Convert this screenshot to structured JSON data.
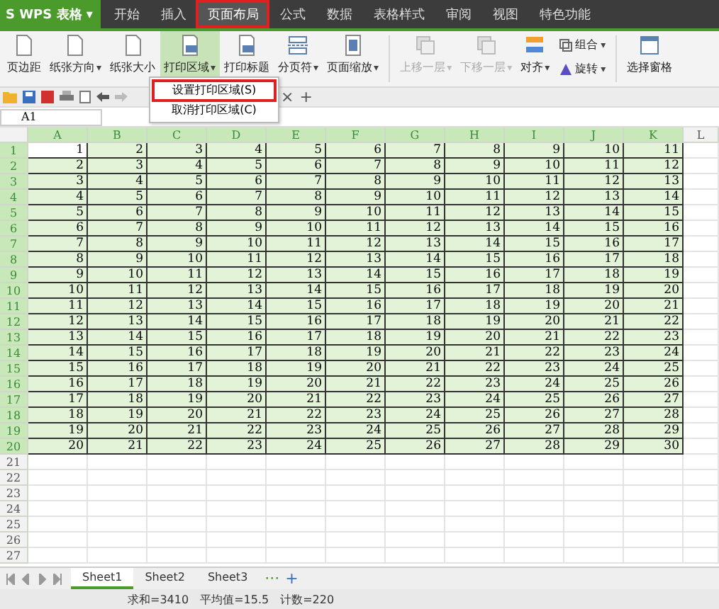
{
  "app": {
    "logo": "S",
    "name": "WPS 表格",
    "caret": "▾"
  },
  "menu_tabs": [
    {
      "label": "开始",
      "selected": false,
      "highlighted": false
    },
    {
      "label": "插入",
      "selected": false,
      "highlighted": false
    },
    {
      "label": "页面布局",
      "selected": true,
      "highlighted": true
    },
    {
      "label": "公式",
      "selected": false,
      "highlighted": false
    },
    {
      "label": "数据",
      "selected": false,
      "highlighted": false
    },
    {
      "label": "表格样式",
      "selected": false,
      "highlighted": false
    },
    {
      "label": "审阅",
      "selected": false,
      "highlighted": false
    },
    {
      "label": "视图",
      "selected": false,
      "highlighted": false
    },
    {
      "label": "特色功能",
      "selected": false,
      "highlighted": false
    }
  ],
  "ribbon": [
    {
      "kind": "large",
      "label": "页边距",
      "dropdown": false,
      "disabled": false,
      "pressed": false
    },
    {
      "kind": "large",
      "label": "纸张方向",
      "dropdown": true,
      "disabled": false,
      "pressed": false
    },
    {
      "kind": "large",
      "label": "纸张大小",
      "dropdown": false,
      "disabled": false,
      "pressed": false
    },
    {
      "kind": "large",
      "label": "打印区域",
      "dropdown": true,
      "disabled": false,
      "pressed": true
    },
    {
      "kind": "large",
      "label": "打印标题",
      "dropdown": false,
      "disabled": false,
      "pressed": false
    },
    {
      "kind": "large",
      "label": "分页符",
      "dropdown": true,
      "disabled": false,
      "pressed": false
    },
    {
      "kind": "large",
      "label": "页面缩放",
      "dropdown": true,
      "disabled": false,
      "pressed": false
    },
    {
      "kind": "separator"
    },
    {
      "kind": "large",
      "label": "上移一层",
      "dropdown": true,
      "disabled": true,
      "pressed": false
    },
    {
      "kind": "large",
      "label": "下移一层",
      "dropdown": true,
      "disabled": true,
      "pressed": false
    },
    {
      "kind": "large",
      "label": "对齐",
      "dropdown": true,
      "disabled": false,
      "pressed": false
    },
    {
      "kind": "stack",
      "items": [
        {
          "label": "组合",
          "dropdown": true
        },
        {
          "label": "旋转",
          "dropdown": true
        }
      ]
    },
    {
      "kind": "separator"
    },
    {
      "kind": "large",
      "label": "选择窗格",
      "dropdown": false,
      "disabled": false,
      "pressed": false
    }
  ],
  "dropdown_caret": "▾",
  "print_area_menu": {
    "items": [
      {
        "label": "设置打印区域(S)",
        "highlighted": true
      },
      {
        "label": "取消打印区域(C)",
        "highlighted": false
      }
    ]
  },
  "document_tab_controls": {
    "close": "×",
    "add": "+"
  },
  "formula_bar": {
    "name_box": "A1"
  },
  "sheet": {
    "columns": [
      {
        "label": "A",
        "shaded": true
      },
      {
        "label": "B",
        "shaded": true
      },
      {
        "label": "C",
        "shaded": true
      },
      {
        "label": "D",
        "shaded": true
      },
      {
        "label": "E",
        "shaded": true
      },
      {
        "label": "F",
        "shaded": true
      },
      {
        "label": "G",
        "shaded": true
      },
      {
        "label": "H",
        "shaded": true
      },
      {
        "label": "I",
        "shaded": true
      },
      {
        "label": "J",
        "shaded": true
      },
      {
        "label": "K",
        "shaded": true
      },
      {
        "label": "L",
        "shaded": false
      }
    ],
    "rows": [
      {
        "header": "1",
        "shaded": true,
        "cells": [
          "1",
          "2",
          "3",
          "4",
          "5",
          "6",
          "7",
          "8",
          "9",
          "10",
          "11"
        ]
      },
      {
        "header": "2",
        "shaded": true,
        "cells": [
          "2",
          "3",
          "4",
          "5",
          "6",
          "7",
          "8",
          "9",
          "10",
          "11",
          "12"
        ]
      },
      {
        "header": "3",
        "shaded": true,
        "cells": [
          "3",
          "4",
          "5",
          "6",
          "7",
          "8",
          "9",
          "10",
          "11",
          "12",
          "13"
        ]
      },
      {
        "header": "4",
        "shaded": true,
        "cells": [
          "4",
          "5",
          "6",
          "7",
          "8",
          "9",
          "10",
          "11",
          "12",
          "13",
          "14"
        ]
      },
      {
        "header": "5",
        "shaded": true,
        "cells": [
          "5",
          "6",
          "7",
          "8",
          "9",
          "10",
          "11",
          "12",
          "13",
          "14",
          "15"
        ]
      },
      {
        "header": "6",
        "shaded": true,
        "cells": [
          "6",
          "7",
          "8",
          "9",
          "10",
          "11",
          "12",
          "13",
          "14",
          "15",
          "16"
        ]
      },
      {
        "header": "7",
        "shaded": true,
        "cells": [
          "7",
          "8",
          "9",
          "10",
          "11",
          "12",
          "13",
          "14",
          "15",
          "16",
          "17"
        ]
      },
      {
        "header": "8",
        "shaded": true,
        "cells": [
          "8",
          "9",
          "10",
          "11",
          "12",
          "13",
          "14",
          "15",
          "16",
          "17",
          "18"
        ]
      },
      {
        "header": "9",
        "shaded": true,
        "cells": [
          "9",
          "10",
          "11",
          "12",
          "13",
          "14",
          "15",
          "16",
          "17",
          "18",
          "19"
        ]
      },
      {
        "header": "10",
        "shaded": true,
        "cells": [
          "10",
          "11",
          "12",
          "13",
          "14",
          "15",
          "16",
          "17",
          "18",
          "19",
          "20"
        ]
      },
      {
        "header": "11",
        "shaded": true,
        "cells": [
          "11",
          "12",
          "13",
          "14",
          "15",
          "16",
          "17",
          "18",
          "19",
          "20",
          "21"
        ]
      },
      {
        "header": "12",
        "shaded": true,
        "cells": [
          "12",
          "13",
          "14",
          "15",
          "16",
          "17",
          "18",
          "19",
          "20",
          "21",
          "22"
        ]
      },
      {
        "header": "13",
        "shaded": true,
        "cells": [
          "13",
          "14",
          "15",
          "16",
          "17",
          "18",
          "19",
          "20",
          "21",
          "22",
          "23"
        ]
      },
      {
        "header": "14",
        "shaded": true,
        "cells": [
          "14",
          "15",
          "16",
          "17",
          "18",
          "19",
          "20",
          "21",
          "22",
          "23",
          "24"
        ]
      },
      {
        "header": "15",
        "shaded": true,
        "cells": [
          "15",
          "16",
          "17",
          "18",
          "19",
          "20",
          "21",
          "22",
          "23",
          "24",
          "25"
        ]
      },
      {
        "header": "16",
        "shaded": true,
        "cells": [
          "16",
          "17",
          "18",
          "19",
          "20",
          "21",
          "22",
          "23",
          "24",
          "25",
          "26"
        ]
      },
      {
        "header": "17",
        "shaded": true,
        "cells": [
          "17",
          "18",
          "19",
          "20",
          "21",
          "22",
          "23",
          "24",
          "25",
          "26",
          "27"
        ]
      },
      {
        "header": "18",
        "shaded": true,
        "cells": [
          "18",
          "19",
          "20",
          "21",
          "22",
          "23",
          "24",
          "25",
          "26",
          "27",
          "28"
        ]
      },
      {
        "header": "19",
        "shaded": true,
        "cells": [
          "19",
          "20",
          "21",
          "22",
          "23",
          "24",
          "25",
          "26",
          "27",
          "28",
          "29"
        ]
      },
      {
        "header": "20",
        "shaded": true,
        "cells": [
          "20",
          "21",
          "22",
          "23",
          "24",
          "25",
          "26",
          "27",
          "28",
          "29",
          "30"
        ]
      },
      {
        "header": "21",
        "shaded": false
      },
      {
        "header": "22",
        "shaded": false
      },
      {
        "header": "23",
        "shaded": false
      },
      {
        "header": "24",
        "shaded": false
      },
      {
        "header": "25",
        "shaded": false
      },
      {
        "header": "26",
        "shaded": false
      },
      {
        "header": "27",
        "shaded": false
      }
    ]
  },
  "sheet_tabs": {
    "tabs": [
      {
        "label": "Sheet1",
        "selected": true
      },
      {
        "label": "Sheet2",
        "selected": false
      },
      {
        "label": "Sheet3",
        "selected": false
      }
    ],
    "more": "···",
    "add": "+"
  },
  "status_bar": [
    "求和=3410",
    "平均值=15.5",
    "计数=220"
  ]
}
